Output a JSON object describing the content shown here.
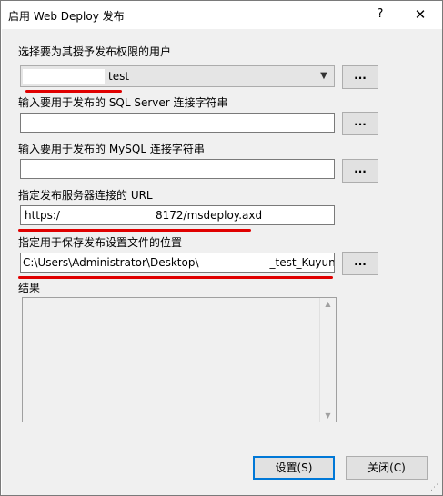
{
  "window": {
    "title": "启用 Web Deploy 发布",
    "help_label": "?",
    "close_label": "✕"
  },
  "user": {
    "label": "选择要为其授予发布权限的用户",
    "value": "test",
    "browse_label": "..."
  },
  "sql": {
    "label": "输入要用于发布的 SQL Server 连接字符串",
    "value": "",
    "browse_label": "..."
  },
  "mysql": {
    "label": "输入要用于发布的 MySQL 连接字符串",
    "value": "",
    "browse_label": "..."
  },
  "url": {
    "label": "指定发布服务器连接的 URL",
    "value_prefix": "https:/",
    "value_suffix": "8172/msdeploy.axd"
  },
  "location": {
    "label": "指定用于保存发布设置文件的位置",
    "value_prefix": "C:\\Users\\Administrator\\Desktop\\",
    "value_suffix": "_test_Kuyun",
    "browse_label": "..."
  },
  "results": {
    "label": "结果"
  },
  "buttons": {
    "setup": "设置(S)",
    "close": "关闭(C)"
  },
  "colors": {
    "annotation_red": "#e00000",
    "primary_border": "#0078d7"
  }
}
